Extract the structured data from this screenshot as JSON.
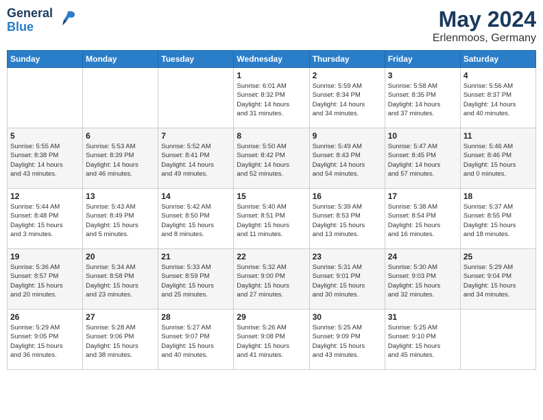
{
  "header": {
    "logo_line1": "General",
    "logo_line2": "Blue",
    "month_year": "May 2024",
    "location": "Erlenmoos, Germany"
  },
  "weekdays": [
    "Sunday",
    "Monday",
    "Tuesday",
    "Wednesday",
    "Thursday",
    "Friday",
    "Saturday"
  ],
  "weeks": [
    [
      {
        "day": "",
        "info": ""
      },
      {
        "day": "",
        "info": ""
      },
      {
        "day": "",
        "info": ""
      },
      {
        "day": "1",
        "info": "Sunrise: 6:01 AM\nSunset: 8:32 PM\nDaylight: 14 hours\nand 31 minutes."
      },
      {
        "day": "2",
        "info": "Sunrise: 5:59 AM\nSunset: 8:34 PM\nDaylight: 14 hours\nand 34 minutes."
      },
      {
        "day": "3",
        "info": "Sunrise: 5:58 AM\nSunset: 8:35 PM\nDaylight: 14 hours\nand 37 minutes."
      },
      {
        "day": "4",
        "info": "Sunrise: 5:56 AM\nSunset: 8:37 PM\nDaylight: 14 hours\nand 40 minutes."
      }
    ],
    [
      {
        "day": "5",
        "info": "Sunrise: 5:55 AM\nSunset: 8:38 PM\nDaylight: 14 hours\nand 43 minutes."
      },
      {
        "day": "6",
        "info": "Sunrise: 5:53 AM\nSunset: 8:39 PM\nDaylight: 14 hours\nand 46 minutes."
      },
      {
        "day": "7",
        "info": "Sunrise: 5:52 AM\nSunset: 8:41 PM\nDaylight: 14 hours\nand 49 minutes."
      },
      {
        "day": "8",
        "info": "Sunrise: 5:50 AM\nSunset: 8:42 PM\nDaylight: 14 hours\nand 52 minutes."
      },
      {
        "day": "9",
        "info": "Sunrise: 5:49 AM\nSunset: 8:43 PM\nDaylight: 14 hours\nand 54 minutes."
      },
      {
        "day": "10",
        "info": "Sunrise: 5:47 AM\nSunset: 8:45 PM\nDaylight: 14 hours\nand 57 minutes."
      },
      {
        "day": "11",
        "info": "Sunrise: 5:46 AM\nSunset: 8:46 PM\nDaylight: 15 hours\nand 0 minutes."
      }
    ],
    [
      {
        "day": "12",
        "info": "Sunrise: 5:44 AM\nSunset: 8:48 PM\nDaylight: 15 hours\nand 3 minutes."
      },
      {
        "day": "13",
        "info": "Sunrise: 5:43 AM\nSunset: 8:49 PM\nDaylight: 15 hours\nand 5 minutes."
      },
      {
        "day": "14",
        "info": "Sunrise: 5:42 AM\nSunset: 8:50 PM\nDaylight: 15 hours\nand 8 minutes."
      },
      {
        "day": "15",
        "info": "Sunrise: 5:40 AM\nSunset: 8:51 PM\nDaylight: 15 hours\nand 11 minutes."
      },
      {
        "day": "16",
        "info": "Sunrise: 5:39 AM\nSunset: 8:53 PM\nDaylight: 15 hours\nand 13 minutes."
      },
      {
        "day": "17",
        "info": "Sunrise: 5:38 AM\nSunset: 8:54 PM\nDaylight: 15 hours\nand 16 minutes."
      },
      {
        "day": "18",
        "info": "Sunrise: 5:37 AM\nSunset: 8:55 PM\nDaylight: 15 hours\nand 18 minutes."
      }
    ],
    [
      {
        "day": "19",
        "info": "Sunrise: 5:36 AM\nSunset: 8:57 PM\nDaylight: 15 hours\nand 20 minutes."
      },
      {
        "day": "20",
        "info": "Sunrise: 5:34 AM\nSunset: 8:58 PM\nDaylight: 15 hours\nand 23 minutes."
      },
      {
        "day": "21",
        "info": "Sunrise: 5:33 AM\nSunset: 8:59 PM\nDaylight: 15 hours\nand 25 minutes."
      },
      {
        "day": "22",
        "info": "Sunrise: 5:32 AM\nSunset: 9:00 PM\nDaylight: 15 hours\nand 27 minutes."
      },
      {
        "day": "23",
        "info": "Sunrise: 5:31 AM\nSunset: 9:01 PM\nDaylight: 15 hours\nand 30 minutes."
      },
      {
        "day": "24",
        "info": "Sunrise: 5:30 AM\nSunset: 9:03 PM\nDaylight: 15 hours\nand 32 minutes."
      },
      {
        "day": "25",
        "info": "Sunrise: 5:29 AM\nSunset: 9:04 PM\nDaylight: 15 hours\nand 34 minutes."
      }
    ],
    [
      {
        "day": "26",
        "info": "Sunrise: 5:29 AM\nSunset: 9:05 PM\nDaylight: 15 hours\nand 36 minutes."
      },
      {
        "day": "27",
        "info": "Sunrise: 5:28 AM\nSunset: 9:06 PM\nDaylight: 15 hours\nand 38 minutes."
      },
      {
        "day": "28",
        "info": "Sunrise: 5:27 AM\nSunset: 9:07 PM\nDaylight: 15 hours\nand 40 minutes."
      },
      {
        "day": "29",
        "info": "Sunrise: 5:26 AM\nSunset: 9:08 PM\nDaylight: 15 hours\nand 41 minutes."
      },
      {
        "day": "30",
        "info": "Sunrise: 5:25 AM\nSunset: 9:09 PM\nDaylight: 15 hours\nand 43 minutes."
      },
      {
        "day": "31",
        "info": "Sunrise: 5:25 AM\nSunset: 9:10 PM\nDaylight: 15 hours\nand 45 minutes."
      },
      {
        "day": "",
        "info": ""
      }
    ]
  ]
}
